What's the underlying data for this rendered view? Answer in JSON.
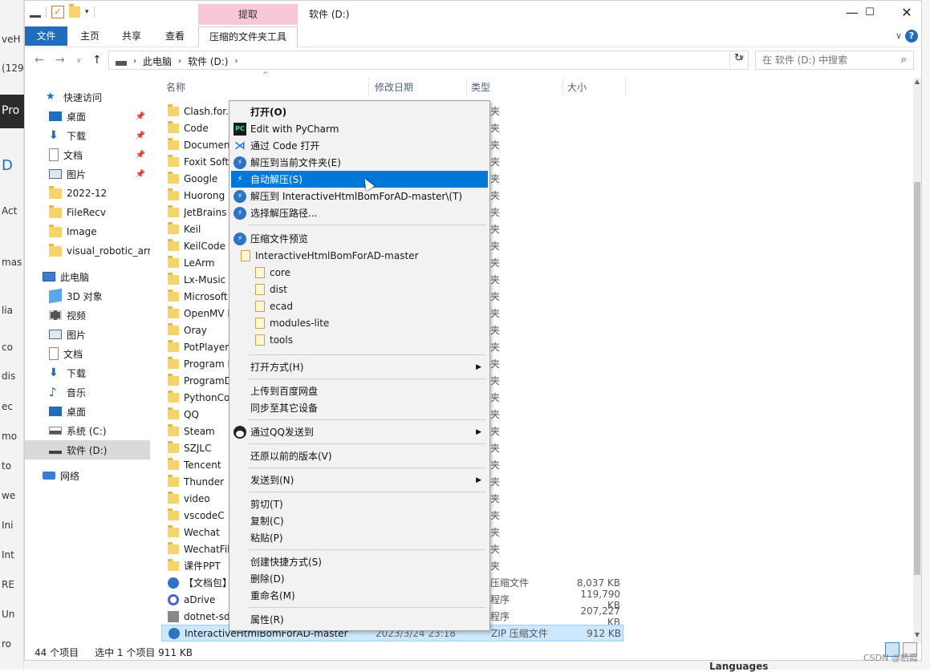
{
  "window": {
    "title": "软件 (D:)",
    "context_tab_header": "提取",
    "ribbon_tabs": [
      "文件",
      "主页",
      "共享",
      "查看",
      "压缩的文件夹工具"
    ],
    "help_icon": "?"
  },
  "address": {
    "crumbs": [
      "此电脑",
      "软件 (D:)"
    ],
    "search_placeholder": "在 软件 (D:) 中搜索"
  },
  "columns": {
    "name": "名称",
    "date": "修改日期",
    "type": "类型",
    "size": "大小"
  },
  "nav": {
    "quick_access": "快速访问",
    "quick_items": [
      "桌面",
      "下载",
      "文档",
      "图片",
      "2022-12",
      "FileRecv",
      "Image",
      "visual_robotic_arm"
    ],
    "this_pc": "此电脑",
    "pc_items": [
      "3D 对象",
      "视频",
      "图片",
      "文档",
      "下载",
      "音乐",
      "桌面",
      "系统 (C:)",
      "软件 (D:)"
    ],
    "network": "网络"
  },
  "files": [
    {
      "name": "Clash.for.W",
      "type": "夹"
    },
    {
      "name": "Code",
      "type": "夹"
    },
    {
      "name": "Documents",
      "type": "夹"
    },
    {
      "name": "Foxit Softw",
      "type": "夹"
    },
    {
      "name": "Google",
      "type": "夹"
    },
    {
      "name": "Huorong",
      "type": "夹"
    },
    {
      "name": "JetBrains",
      "type": "夹"
    },
    {
      "name": "Keil",
      "type": "夹"
    },
    {
      "name": "KeilCode",
      "type": "夹"
    },
    {
      "name": "LeArm",
      "type": "夹"
    },
    {
      "name": "Lx-Music",
      "type": "夹"
    },
    {
      "name": "Microsoft",
      "type": "夹"
    },
    {
      "name": "OpenMV I",
      "type": "夹"
    },
    {
      "name": "Oray",
      "type": "夹"
    },
    {
      "name": "PotPlayer",
      "type": "夹"
    },
    {
      "name": "Program F",
      "type": "夹"
    },
    {
      "name": "ProgramD",
      "type": "夹"
    },
    {
      "name": "PythonCod",
      "type": "夹"
    },
    {
      "name": "QQ",
      "type": "夹"
    },
    {
      "name": "Steam",
      "type": "夹"
    },
    {
      "name": "SZJLC",
      "type": "夹"
    },
    {
      "name": "Tencent",
      "type": "夹"
    },
    {
      "name": "Thunder",
      "type": "夹"
    },
    {
      "name": "video",
      "type": "夹"
    },
    {
      "name": "vscodeC",
      "type": "夹"
    },
    {
      "name": "Wechat",
      "type": "夹"
    },
    {
      "name": "WechatFile",
      "type": "夹"
    },
    {
      "name": "课件PPT",
      "type": "夹"
    },
    {
      "name": "【文档包】",
      "type": "压缩文件",
      "size": "8,037 KB"
    },
    {
      "name": "aDrive",
      "type": "程序",
      "size": "119,790 KB"
    },
    {
      "name": "dotnet-sd",
      "type": "程序",
      "size": "207,227 KB"
    },
    {
      "name": "InteractiveHtmlBomForAD-master",
      "date": "2023/3/24 23:18",
      "type": "ZIP 压缩文件",
      "size": "912 KB"
    }
  ],
  "context_menu": {
    "open": "打开(O)",
    "pycharm": "Edit with PyCharm",
    "code": "通过 Code 打开",
    "extract_here": "解压到当前文件夹(E)",
    "auto_extract": "自动解压(S)",
    "extract_to": "解压到 InteractiveHtmlBomForAD-master\\(T)",
    "choose_path": "选择解压路径...",
    "preview": "压缩文件预览",
    "tree_root": "InteractiveHtmlBomForAD-master",
    "tree_children": [
      "core",
      "dist",
      "ecad",
      "modules-lite",
      "tools"
    ],
    "open_with": "打开方式(H)",
    "upload_baidu": "上传到百度网盘",
    "sync_devices": "同步至其它设备",
    "send_qq": "通过QQ发送到",
    "restore": "还原以前的版本(V)",
    "send_to": "发送到(N)",
    "cut": "剪切(T)",
    "copy": "复制(C)",
    "paste": "粘贴(P)",
    "shortcut": "创建快捷方式(S)",
    "delete": "删除(D)",
    "rename": "重命名(M)",
    "properties": "属性(R)"
  },
  "status": {
    "count": "44 个项目",
    "selected": "选中 1 个项目  911 KB"
  },
  "background": {
    "left_texts": [
      "veH",
      "(129",
      "Pro",
      "D",
      "Act",
      "mas",
      "lia",
      "co",
      "dis",
      "ec",
      "mo",
      "to",
      "we",
      "Ini",
      "Int",
      "RE",
      "Un",
      "ro"
    ],
    "languages": "Languages",
    "watermark": "CSDN @栖霞"
  }
}
